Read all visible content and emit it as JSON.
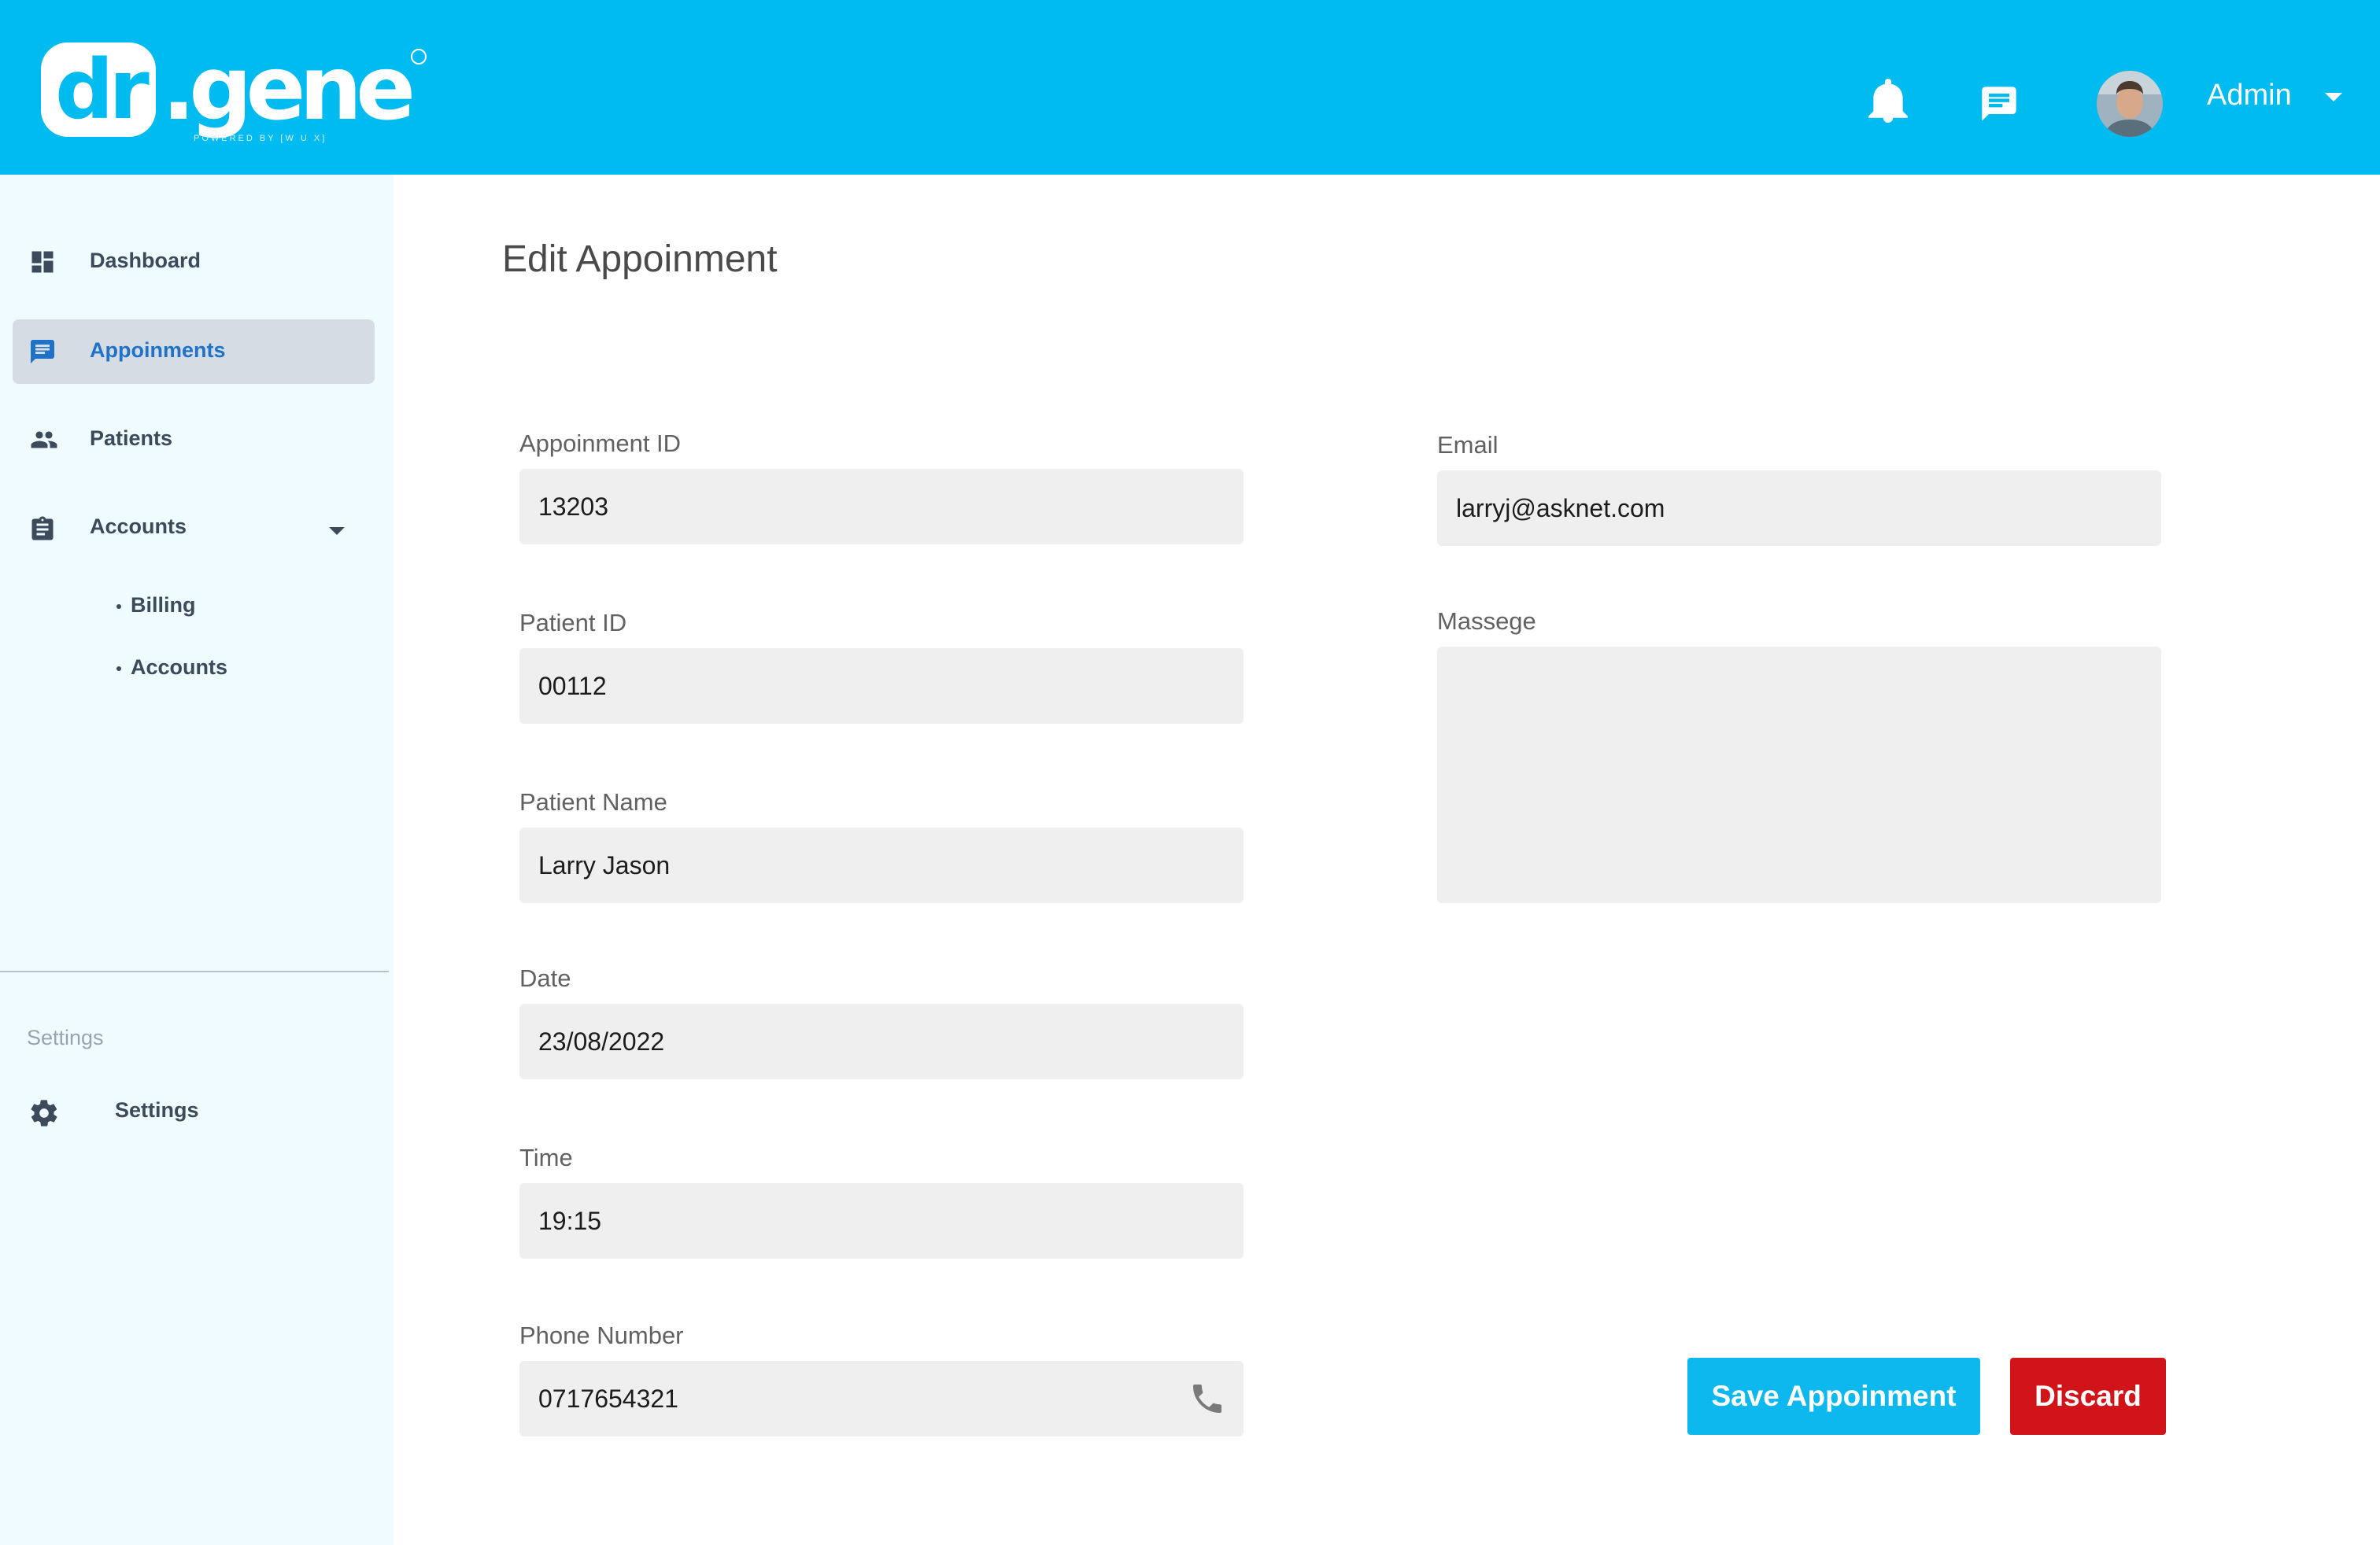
{
  "colors": {
    "header": "#00BBF0",
    "sidebar": "#EFFBFF",
    "active_nav_bg": "#D6DCE4",
    "save": "#0DB8EE",
    "discard": "#D0141A"
  },
  "header": {
    "logo": {
      "part1": "dr",
      "part2": ".gene",
      "tagline": "POWERED BY [W U X]"
    },
    "icons": [
      "bell-icon",
      "chat-icon"
    ],
    "user": {
      "name": "Admin"
    }
  },
  "sidebar": {
    "items": [
      {
        "label": "Dashboard",
        "icon": "dashboard-icon"
      },
      {
        "label": "Appoinments",
        "icon": "chat-icon",
        "active": true
      },
      {
        "label": "Patients",
        "icon": "people-icon"
      },
      {
        "label": "Accounts",
        "icon": "clipboard-icon",
        "expanded": true
      }
    ],
    "subitems": [
      {
        "label": "Billing"
      },
      {
        "label": "Accounts"
      }
    ],
    "section_title": "Settings",
    "settings": {
      "label": "Settings",
      "icon": "gear-icon"
    }
  },
  "main": {
    "title": "Edit Appoinment",
    "fields": {
      "appointment_id": {
        "label": "Appoinment ID",
        "value": "13203"
      },
      "patient_id": {
        "label": "Patient ID",
        "value": "00112"
      },
      "patient_name": {
        "label": "Patient Name",
        "value": "Larry Jason"
      },
      "date": {
        "label": "Date",
        "value": "23/08/2022"
      },
      "time": {
        "label": "Time",
        "value": "19:15"
      },
      "phone": {
        "label": "Phone Number",
        "value": "0717654321"
      },
      "email": {
        "label": "Email",
        "value": "larryj@asknet.com"
      },
      "message": {
        "label": "Massege",
        "value": ""
      }
    },
    "buttons": {
      "save": "Save Appoinment",
      "discard": "Discard"
    }
  }
}
